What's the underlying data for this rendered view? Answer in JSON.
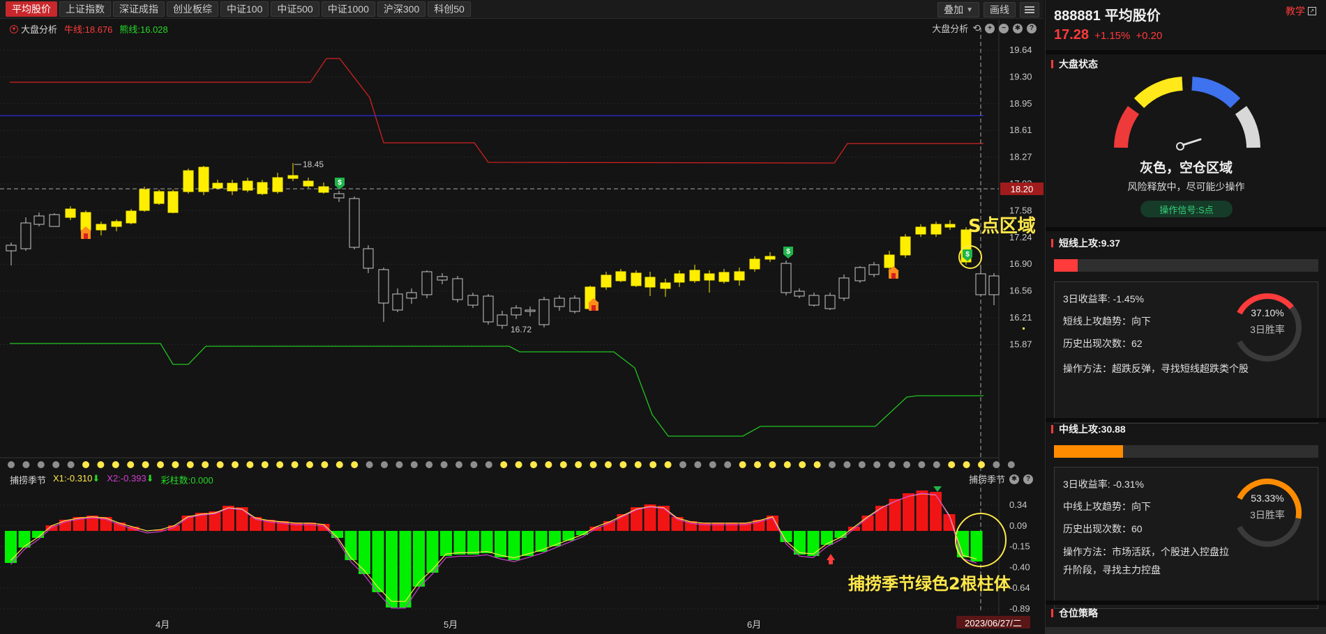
{
  "index_tabs": [
    "平均股价",
    "上证指数",
    "深证成指",
    "创业板综",
    "中证100",
    "中证500",
    "中证1000",
    "沪深300",
    "科创50"
  ],
  "active_tab_index": 0,
  "top_buttons": {
    "overlay": "叠加",
    "draw": "画线"
  },
  "main_chart": {
    "indicator_name": "大盘分析",
    "bull_line": "牛线:18.676",
    "bear_line": "熊线:16.028",
    "tool_label": "大盘分析",
    "y_ticks": [
      "19.64",
      "19.30",
      "18.95",
      "18.61",
      "18.27",
      "17.93",
      "17.58",
      "17.24",
      "16.90",
      "16.56",
      "16.21",
      "15.87"
    ],
    "current_price_tag": "18.20",
    "high_label": "18.45",
    "low_label": "16.72",
    "annotation": "S点区域"
  },
  "sub_chart": {
    "indicator_name": "捕捞季节",
    "x1": "X1:-0.310",
    "x2": "X2:-0.393",
    "bar_count": "彩柱数:0.000",
    "tool_label": "捕捞季节",
    "y_ticks": [
      "0.34",
      "0.09",
      "-0.15",
      "-0.40",
      "-0.64",
      "-0.89"
    ],
    "annotation": "捕捞季节绿色2根柱体"
  },
  "x_axis": {
    "labels": [
      "4月",
      "5月",
      "6月"
    ],
    "current_date": "2023/06/27/二"
  },
  "right_panel": {
    "code": "888881",
    "name": "平均股价",
    "price": "17.28",
    "change_pct": "+1.15%",
    "change_abs": "+0.20",
    "teach": "教学",
    "market_state": {
      "title": "大盘状态",
      "zone": "灰色，空仓区域",
      "advice": "风险释放中，尽可能少操作",
      "signal": "操作信号:S点"
    },
    "short_attack": {
      "title": "短线上攻:9.37",
      "progress": 0.09,
      "ret3": "3日收益率: -1.45%",
      "trend": "短线上攻趋势：向下",
      "count": "历史出现次数：62",
      "method": "操作方法：超跌反弹，寻找短线超跌类个股",
      "win_rate": "37.10%",
      "win_label": "3日胜率",
      "win_value": 0.371,
      "color": "#ff3b3b"
    },
    "mid_attack": {
      "title": "中线上攻:30.88",
      "progress": 0.26,
      "ret3": "3日收益率: -0.31%",
      "trend": "中线上攻趋势：向下",
      "count": "历史出现次数：60",
      "method": "操作方法：市场活跃，个股进入控盘拉升阶段，寻找主力控盘",
      "win_rate": "53.33%",
      "win_label": "3日胜率",
      "win_value": 0.5333,
      "color": "#ff8c00"
    },
    "position_strategy": {
      "title": "仓位策略"
    }
  }
}
